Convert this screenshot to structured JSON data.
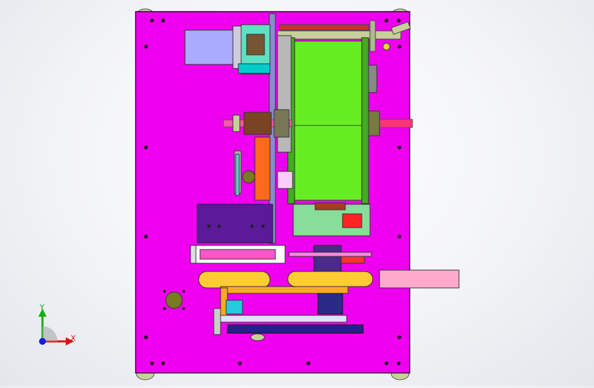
{
  "window": {
    "title": ""
  },
  "triad": {
    "x_label": "X",
    "y_label": "Y",
    "z_label": ""
  },
  "colors": {
    "background": "#f1f2f5",
    "plate": "#ee00ee",
    "plate_edge": "#3a003a",
    "drum": "#66ee22",
    "motor": "#aaaaff",
    "orange": "#ff6a1a",
    "yellow": "#ffcc33",
    "navy": "#2a2a88",
    "pink_box": "#ffaacc",
    "axis_x": "#e01010",
    "axis_y": "#10b010",
    "axis_z": "#1020e0"
  },
  "icons": [
    "coordinate-triad-icon"
  ]
}
